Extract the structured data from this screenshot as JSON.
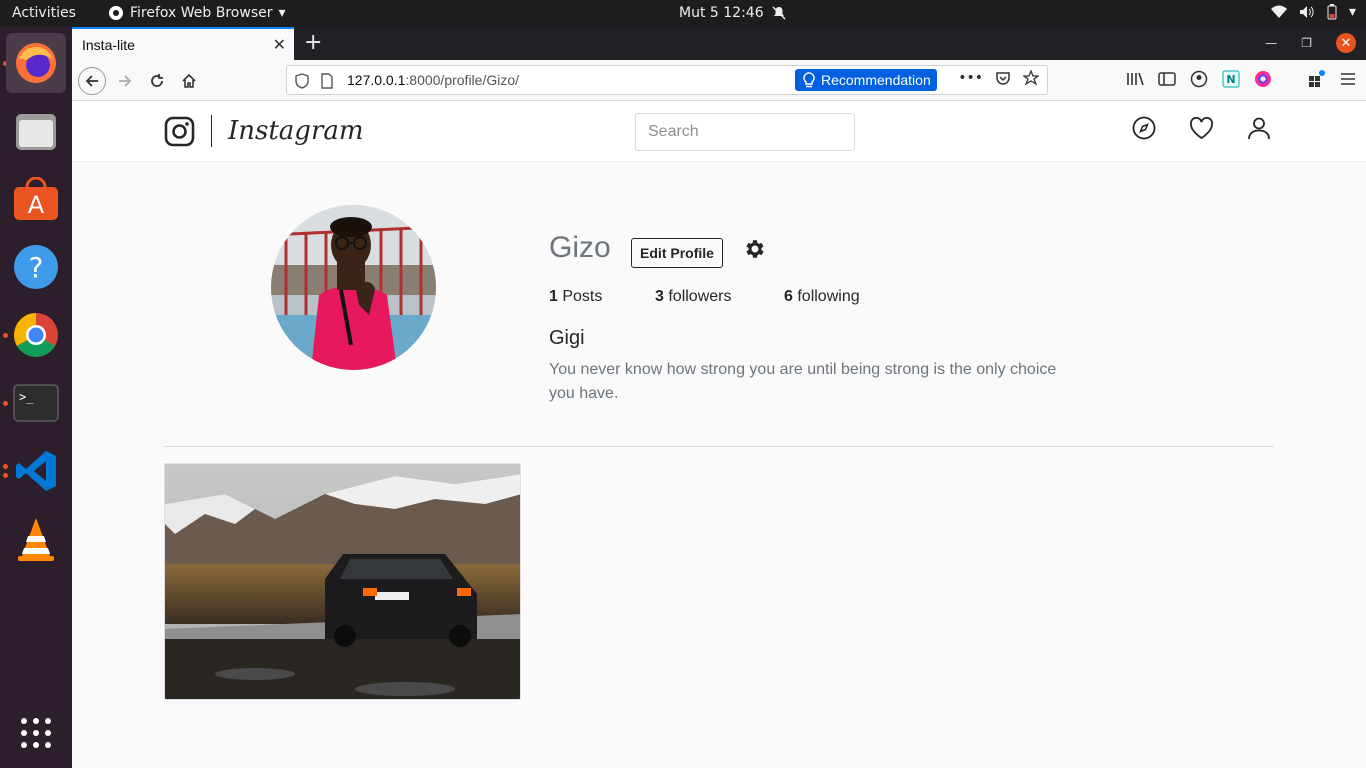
{
  "topbar": {
    "activities": "Activities",
    "app_name": "Firefox Web Browser",
    "clock": "Mut 5  12:46"
  },
  "browser": {
    "tab_title": "Insta-lite",
    "url_host": "127.0.0.1",
    "url_rest": ":8000/profile/Gizo/",
    "recommendation_label": "Recommendation"
  },
  "header": {
    "wordmark": "Instagram",
    "search_placeholder": "Search"
  },
  "profile": {
    "username": "Gizo",
    "edit_label": "Edit Profile",
    "posts_count": "1",
    "posts_label": " Posts",
    "followers_count": "3",
    "followers_label": " followers",
    "following_count": "6",
    "following_label": " following",
    "full_name": "Gigi",
    "bio": "You never know how strong you are until being strong is the only choice you have."
  },
  "colors": {
    "accent": "#0a84ff",
    "ubuntu_orange": "#e95420",
    "page_bg": "#fafafa"
  }
}
